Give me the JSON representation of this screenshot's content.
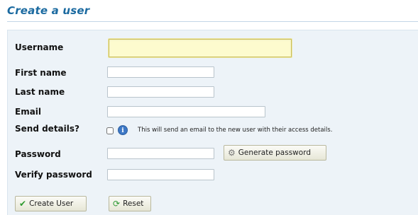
{
  "page": {
    "title": "Create a user"
  },
  "form": {
    "username": {
      "label": "Username",
      "value": ""
    },
    "first_name": {
      "label": "First name",
      "value": ""
    },
    "last_name": {
      "label": "Last name",
      "value": ""
    },
    "email": {
      "label": "Email",
      "value": ""
    },
    "send_details": {
      "label": "Send details?",
      "checked": false,
      "hint": "This will send an email to the new user with their access details."
    },
    "password": {
      "label": "Password",
      "value": ""
    },
    "generate_password": {
      "label": "Generate password"
    },
    "verify_password": {
      "label": "Verify password",
      "value": ""
    }
  },
  "actions": {
    "create_label": "Create User",
    "reset_label": "Reset"
  },
  "icons": {
    "info": "info-icon",
    "generate": "gear-icon",
    "create": "checkmark-icon",
    "reset": "refresh-icon"
  },
  "colors": {
    "title": "#1b6aa0",
    "panel": "#edf3f8",
    "focused_field": "#fdfbce"
  }
}
